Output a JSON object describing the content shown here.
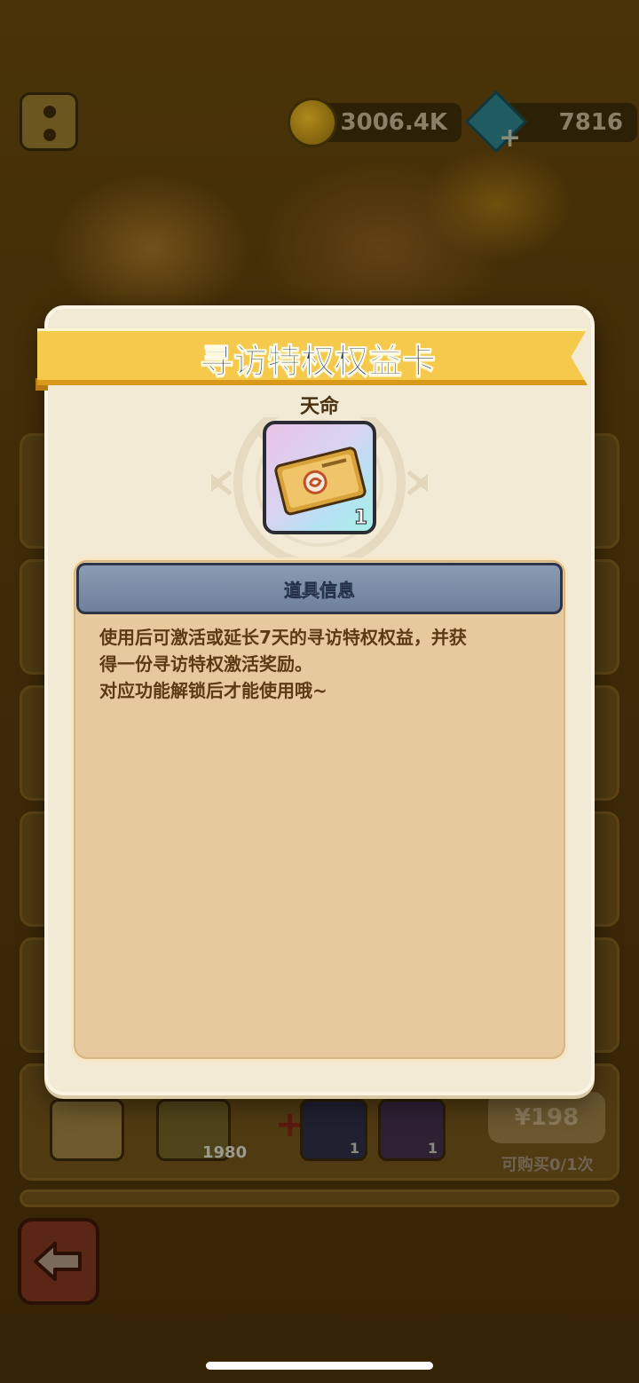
{
  "currencies": {
    "coins": "3006.4K",
    "gems": "7816"
  },
  "dialog": {
    "title": "寻访特权权益卡",
    "item_name": "天命",
    "item_quantity": "1",
    "info_header": "道具信息",
    "description_line1": "使用后可激活或延长7天的寻访特权权益，并获",
    "description_line2": "得一份寻访特权激活奖励。",
    "description_line3": "对应功能解锁后才能使用哦~"
  },
  "shop_row": {
    "gem_count": "1980",
    "slot_qty_a": "1",
    "slot_qty_b": "1",
    "price": "¥198",
    "purchase_limit": "可购买0/1次"
  },
  "colors": {
    "ribbon": "#f4c94c",
    "dialog_bg": "#f3ead6",
    "info_panel": "#e6c99c",
    "info_header": "#7b8ca7",
    "title_text": "#1f3c5a"
  }
}
